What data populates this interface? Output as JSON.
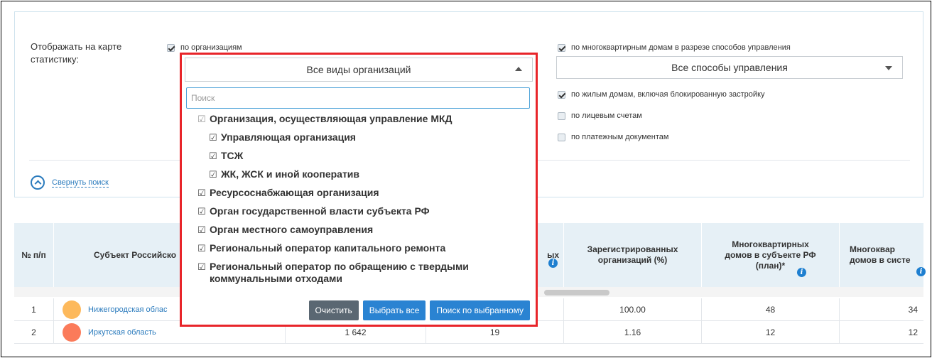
{
  "filters": {
    "label": "Отображать на карте статистику:",
    "by_orgs_label": "по организациям",
    "by_orgs_checked": true,
    "by_mkd_label": "по многоквартирным домам в разрезе способов управления",
    "by_mkd_checked": true,
    "mgmt_select_value": "Все способы управления",
    "by_houses_label": "по жилым домам, включая блокированную застройку",
    "by_houses_checked": true,
    "by_accounts_label": "по лицевым счетам",
    "by_accounts_checked": false,
    "by_payments_label": "по платежным документам",
    "by_payments_checked": false,
    "collapse_label": "Свернуть поиск"
  },
  "dropdown": {
    "select_value": "Все виды организаций",
    "search_placeholder": "Поиск",
    "items": [
      {
        "label": "Организация, осуществляющая управление МКД",
        "level": 1,
        "checked": true,
        "muted": true
      },
      {
        "label": "Управляющая организация",
        "level": 2,
        "checked": true,
        "muted": false
      },
      {
        "label": "ТСЖ",
        "level": 2,
        "checked": true,
        "muted": false
      },
      {
        "label": "ЖК, ЖСК и иной кооператив",
        "level": 2,
        "checked": true,
        "muted": false
      },
      {
        "label": "Ресурсоснабжающая организация",
        "level": 0,
        "checked": true,
        "muted": false
      },
      {
        "label": "Орган государственной власти субъекта РФ",
        "level": 0,
        "checked": true,
        "muted": false
      },
      {
        "label": "Орган местного самоуправления",
        "level": 0,
        "checked": true,
        "muted": false
      },
      {
        "label": "Региональный оператор капитального ремонта",
        "level": 0,
        "checked": true,
        "muted": false
      },
      {
        "label": "Региональный оператор по обращению с твердыми",
        "label2": "коммунальными отходами",
        "level": 0,
        "checked": true,
        "muted": false
      }
    ],
    "btn_clear": "Очистить",
    "btn_select_all": "Выбрать все",
    "btn_search_selected": "Поиск по выбранному"
  },
  "table": {
    "headers": {
      "num": "№ п/п",
      "subject": "Субъект Российско",
      "hidden_partial": "ых",
      "registered_pct": "Зарегистрированных организаций (%)",
      "mkd_plan": "Многоквартирных домов в субъекте РФ (план)*",
      "mkd_system": "Многоквар домов в систе"
    },
    "rows": [
      {
        "num": "1",
        "region": "Нижегородская облас",
        "color": "#fdb95c",
        "c3": "",
        "c4": "",
        "registered_pct": "100.00",
        "mkd_plan": "48",
        "mkd_system": "34"
      },
      {
        "num": "2",
        "region": "Иркутская область",
        "color": "#fb7b5a",
        "c3": "1 642",
        "c4": "19",
        "registered_pct": "1.16",
        "mkd_plan": "12",
        "mkd_system": "12"
      }
    ]
  },
  "colors": {
    "accent": "#2b7bbd",
    "highlight_border": "#e8252a",
    "button_blue": "#2a83d2",
    "button_gray": "#5a6772"
  }
}
